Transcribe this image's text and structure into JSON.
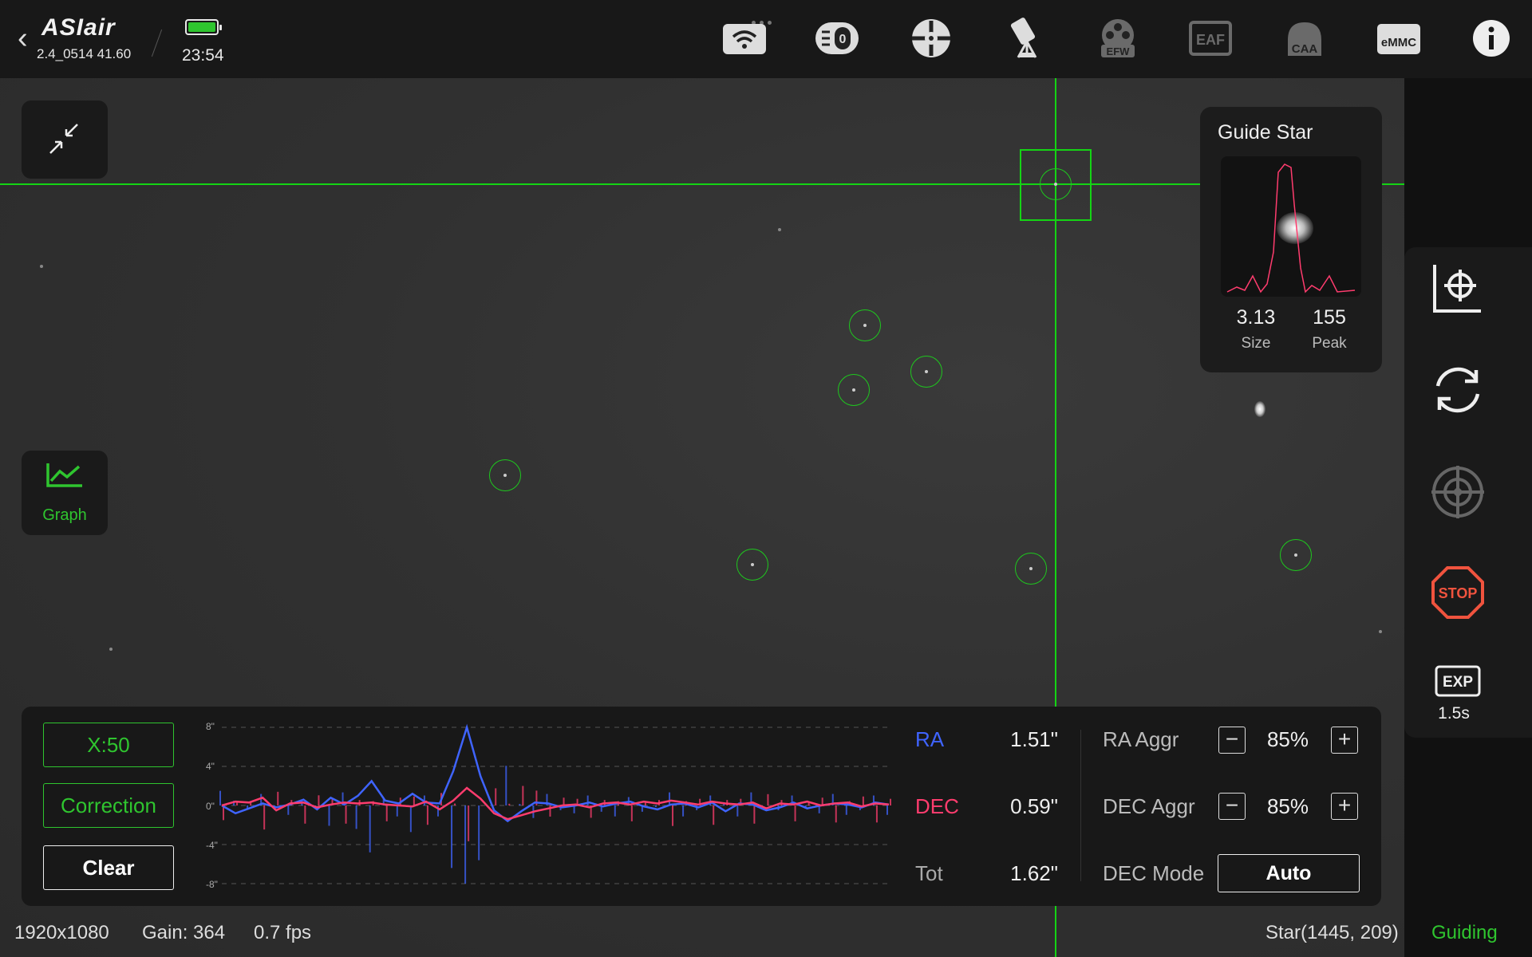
{
  "header": {
    "app_name": "ASIair",
    "firmware": "2.4_0514 41.60",
    "time": "23:54",
    "battery_color": "#2fc52f",
    "icons": [
      "wifi-icon",
      "storage-icon",
      "guide-scope-icon",
      "telescope-mount-icon",
      "efw-icon",
      "eaf-icon",
      "caa-icon",
      "emmc-icon",
      "info-icon"
    ],
    "efw_label": "EFW",
    "eaf_label": "EAF",
    "caa_label": "CAA",
    "emmc_label": "eMMC"
  },
  "left": {
    "graph_label": "Graph"
  },
  "guide_star": {
    "title": "Guide Star",
    "size_value": "3.13",
    "size_label": "Size",
    "peak_value": "155",
    "peak_label": "Peak"
  },
  "right": {
    "icons": [
      "calibrate-icon",
      "loop-icon",
      "guide-target-icon",
      "stop-icon",
      "exposure-icon"
    ],
    "stop_label": "STOP",
    "exp_icon_label": "EXP",
    "exposure": "1.5s"
  },
  "guiding": {
    "x_button": "X:50",
    "correction_button": "Correction",
    "clear_button": "Clear",
    "y_ticks": [
      "8\"",
      "4\"",
      "0\"",
      "-4\"",
      "-8\""
    ],
    "ra_label": "RA",
    "ra_value": "1.51\"",
    "dec_label": "DEC",
    "dec_value": "0.59\"",
    "tot_label": "Tot",
    "tot_value": "1.62\"",
    "ra_aggr_label": "RA Aggr",
    "ra_aggr_value": "85%",
    "dec_aggr_label": "DEC Aggr",
    "dec_aggr_value": "85%",
    "dec_mode_label": "DEC Mode",
    "dec_mode_value": "Auto",
    "ra_color": "#3f64ff",
    "dec_color": "#ff3c6e"
  },
  "chart_data": {
    "type": "line",
    "ylim": [
      -8,
      8
    ],
    "series": [
      {
        "name": "RA",
        "values": [
          0,
          -0.8,
          -0.3,
          0.2,
          -0.2,
          0.1,
          0.6,
          -0.4,
          0.8,
          0.1,
          1.0,
          2.5,
          0.5,
          0.2,
          1.2,
          0.3,
          0.2,
          3.5,
          8.0,
          3.0,
          -0.5,
          -1.6,
          -0.6,
          0.3,
          0.2,
          -0.2,
          0.0,
          0.3,
          -0.1,
          0.2,
          0.4,
          -0.1,
          -0.4,
          0.1,
          0.2,
          -0.2,
          0.3,
          -0.6,
          0.2,
          0.1,
          -0.5,
          -0.2,
          0.3,
          -0.3,
          0.0,
          0.2,
          0.1,
          -0.2,
          0.3,
          0.1
        ]
      },
      {
        "name": "DEC",
        "values": [
          0,
          0.4,
          0.3,
          0.8,
          -0.5,
          0.2,
          0.3,
          -0.2,
          0.1,
          0.3,
          0.2,
          0.3,
          0.1,
          0.0,
          -0.1,
          0.4,
          -0.4,
          0.5,
          1.8,
          0.7,
          -0.8,
          -1.4,
          -1.0,
          -0.6,
          -0.3,
          0.0,
          0.1,
          -0.2,
          0.2,
          0.3,
          0.1,
          0.4,
          0.2,
          0.5,
          0.3,
          0.1,
          0.4,
          0.2,
          0.1,
          0.3,
          -0.3,
          0.2,
          0.1,
          0.4,
          0.0,
          0.2,
          0.3,
          -0.1,
          0.2,
          0.1
        ]
      }
    ]
  },
  "status_bar": {
    "resolution": "1920x1080",
    "gain": "Gain: 364",
    "fps": "0.7 fps",
    "star": "Star(1445, 209)",
    "state": "Guiding"
  }
}
